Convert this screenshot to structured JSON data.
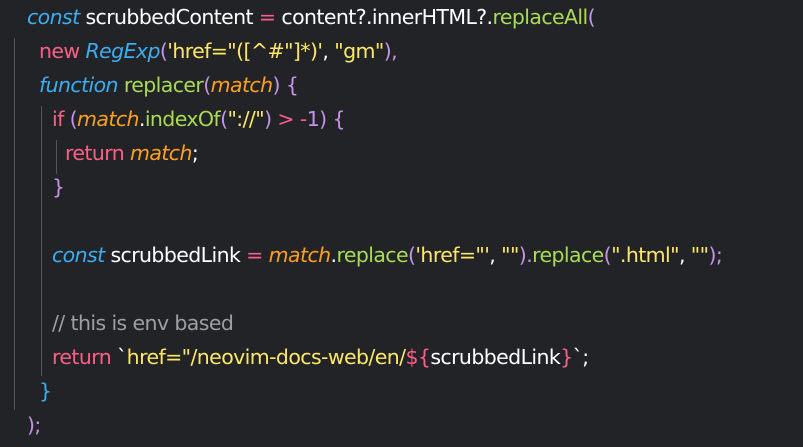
{
  "colors": {
    "background": "#222327",
    "keyword": "#ff5f87",
    "storage": "#3cadf0",
    "variable": "#ffffff",
    "function": "#a9dc54",
    "string": "#fde767",
    "parameter": "#ff9f1c",
    "punctuation": "#c792ea",
    "operator": "#fc5d8b",
    "comment": "#9aa0a6",
    "indent_guide": "#55565c"
  },
  "code_lines": [
    {
      "tokens": [
        {
          "text": "const",
          "color": "storage",
          "italic": true
        },
        {
          "text": " scrubbedContent ",
          "color": "variable"
        },
        {
          "text": "=",
          "color": "operator"
        },
        {
          "text": " content?.innerHTML?.",
          "color": "variable"
        },
        {
          "text": "replaceAll",
          "color": "function"
        },
        {
          "text": "(",
          "color": "punctuation"
        }
      ]
    },
    {
      "tokens": [
        {
          "text": "new",
          "color": "keyword"
        },
        {
          "text": " ",
          "color": "variable"
        },
        {
          "text": "RegExp",
          "color": "storage",
          "italic": true
        },
        {
          "text": "(",
          "color": "punctuation"
        },
        {
          "text": "'href=\"([^#\"]*)'",
          "color": "string"
        },
        {
          "text": ", ",
          "color": "variable"
        },
        {
          "text": "\"gm\"",
          "color": "string"
        },
        {
          "text": "),",
          "color": "punctuation"
        }
      ]
    },
    {
      "tokens": [
        {
          "text": "function",
          "color": "storage",
          "italic": true
        },
        {
          "text": " ",
          "color": "variable"
        },
        {
          "text": "replacer",
          "color": "function"
        },
        {
          "text": "(",
          "color": "punctuation"
        },
        {
          "text": "match",
          "color": "parameter",
          "italic": true
        },
        {
          "text": ") {",
          "color": "punctuation"
        }
      ]
    },
    {
      "tokens": [
        {
          "text": "if",
          "color": "keyword"
        },
        {
          "text": " (",
          "color": "punctuation"
        },
        {
          "text": "match",
          "color": "parameter",
          "italic": true
        },
        {
          "text": ".",
          "color": "variable"
        },
        {
          "text": "indexOf",
          "color": "function"
        },
        {
          "text": "(",
          "color": "punctuation"
        },
        {
          "text": "\"://\"",
          "color": "string"
        },
        {
          "text": ") ",
          "color": "punctuation"
        },
        {
          "text": ">",
          "color": "operator"
        },
        {
          "text": " -",
          "color": "operator"
        },
        {
          "text": "1",
          "color": "punctuation"
        },
        {
          "text": ") {",
          "color": "punctuation"
        }
      ]
    },
    {
      "tokens": [
        {
          "text": "return",
          "color": "keyword"
        },
        {
          "text": " ",
          "color": "variable"
        },
        {
          "text": "match",
          "color": "parameter",
          "italic": true
        },
        {
          "text": ";",
          "color": "variable"
        }
      ]
    },
    {
      "tokens": [
        {
          "text": "}",
          "color": "punctuation"
        }
      ]
    },
    {
      "tokens": []
    },
    {
      "tokens": [
        {
          "text": "const",
          "color": "storage",
          "italic": true
        },
        {
          "text": " scrubbedLink ",
          "color": "variable"
        },
        {
          "text": "=",
          "color": "operator"
        },
        {
          "text": " ",
          "color": "variable"
        },
        {
          "text": "match",
          "color": "parameter",
          "italic": true
        },
        {
          "text": ".",
          "color": "variable"
        },
        {
          "text": "replace",
          "color": "function"
        },
        {
          "text": "(",
          "color": "punctuation"
        },
        {
          "text": "'href=\"'",
          "color": "string"
        },
        {
          "text": ", ",
          "color": "variable"
        },
        {
          "text": "\"\"",
          "color": "string"
        },
        {
          "text": ").",
          "color": "punctuation"
        },
        {
          "text": "replace",
          "color": "function"
        },
        {
          "text": "(",
          "color": "punctuation"
        },
        {
          "text": "\".html\"",
          "color": "string"
        },
        {
          "text": ", ",
          "color": "variable"
        },
        {
          "text": "\"\"",
          "color": "string"
        },
        {
          "text": ");",
          "color": "punctuation"
        }
      ]
    },
    {
      "tokens": []
    },
    {
      "tokens": [
        {
          "text": "// this is env based",
          "color": "comment"
        }
      ]
    },
    {
      "tokens": [
        {
          "text": "return",
          "color": "keyword"
        },
        {
          "text": " `",
          "color": "variable"
        },
        {
          "text": "href=\"/neovim-docs-web/en/",
          "color": "string"
        },
        {
          "text": "${",
          "color": "keyword"
        },
        {
          "text": "scrubbedLink",
          "color": "variable"
        },
        {
          "text": "}",
          "color": "keyword"
        },
        {
          "text": "`",
          "color": "variable"
        },
        {
          "text": ";",
          "color": "variable"
        }
      ]
    },
    {
      "tokens": [
        {
          "text": "}",
          "color": "storage"
        }
      ]
    },
    {
      "tokens": [
        {
          "text": ");",
          "color": "punctuation"
        }
      ]
    }
  ]
}
